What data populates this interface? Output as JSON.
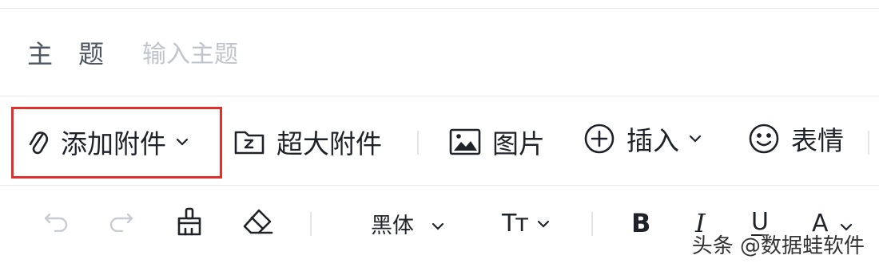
{
  "subject": {
    "label": "主题",
    "placeholder": "输入主题",
    "value": ""
  },
  "toolbar": {
    "add_attachment": "添加附件",
    "large_attachment": "超大附件",
    "image": "图片",
    "insert": "插入",
    "emoji": "表情"
  },
  "format": {
    "font": "黑体",
    "font_size_glyph": "Tт",
    "bold": "B",
    "italic": "I",
    "underline": "U",
    "font_color": "A"
  },
  "watermark": "头条 @数据蛙软件",
  "colors": {
    "highlight": "#e0302c",
    "separator": "#e8eaee",
    "placeholder": "#c0c4cc"
  }
}
